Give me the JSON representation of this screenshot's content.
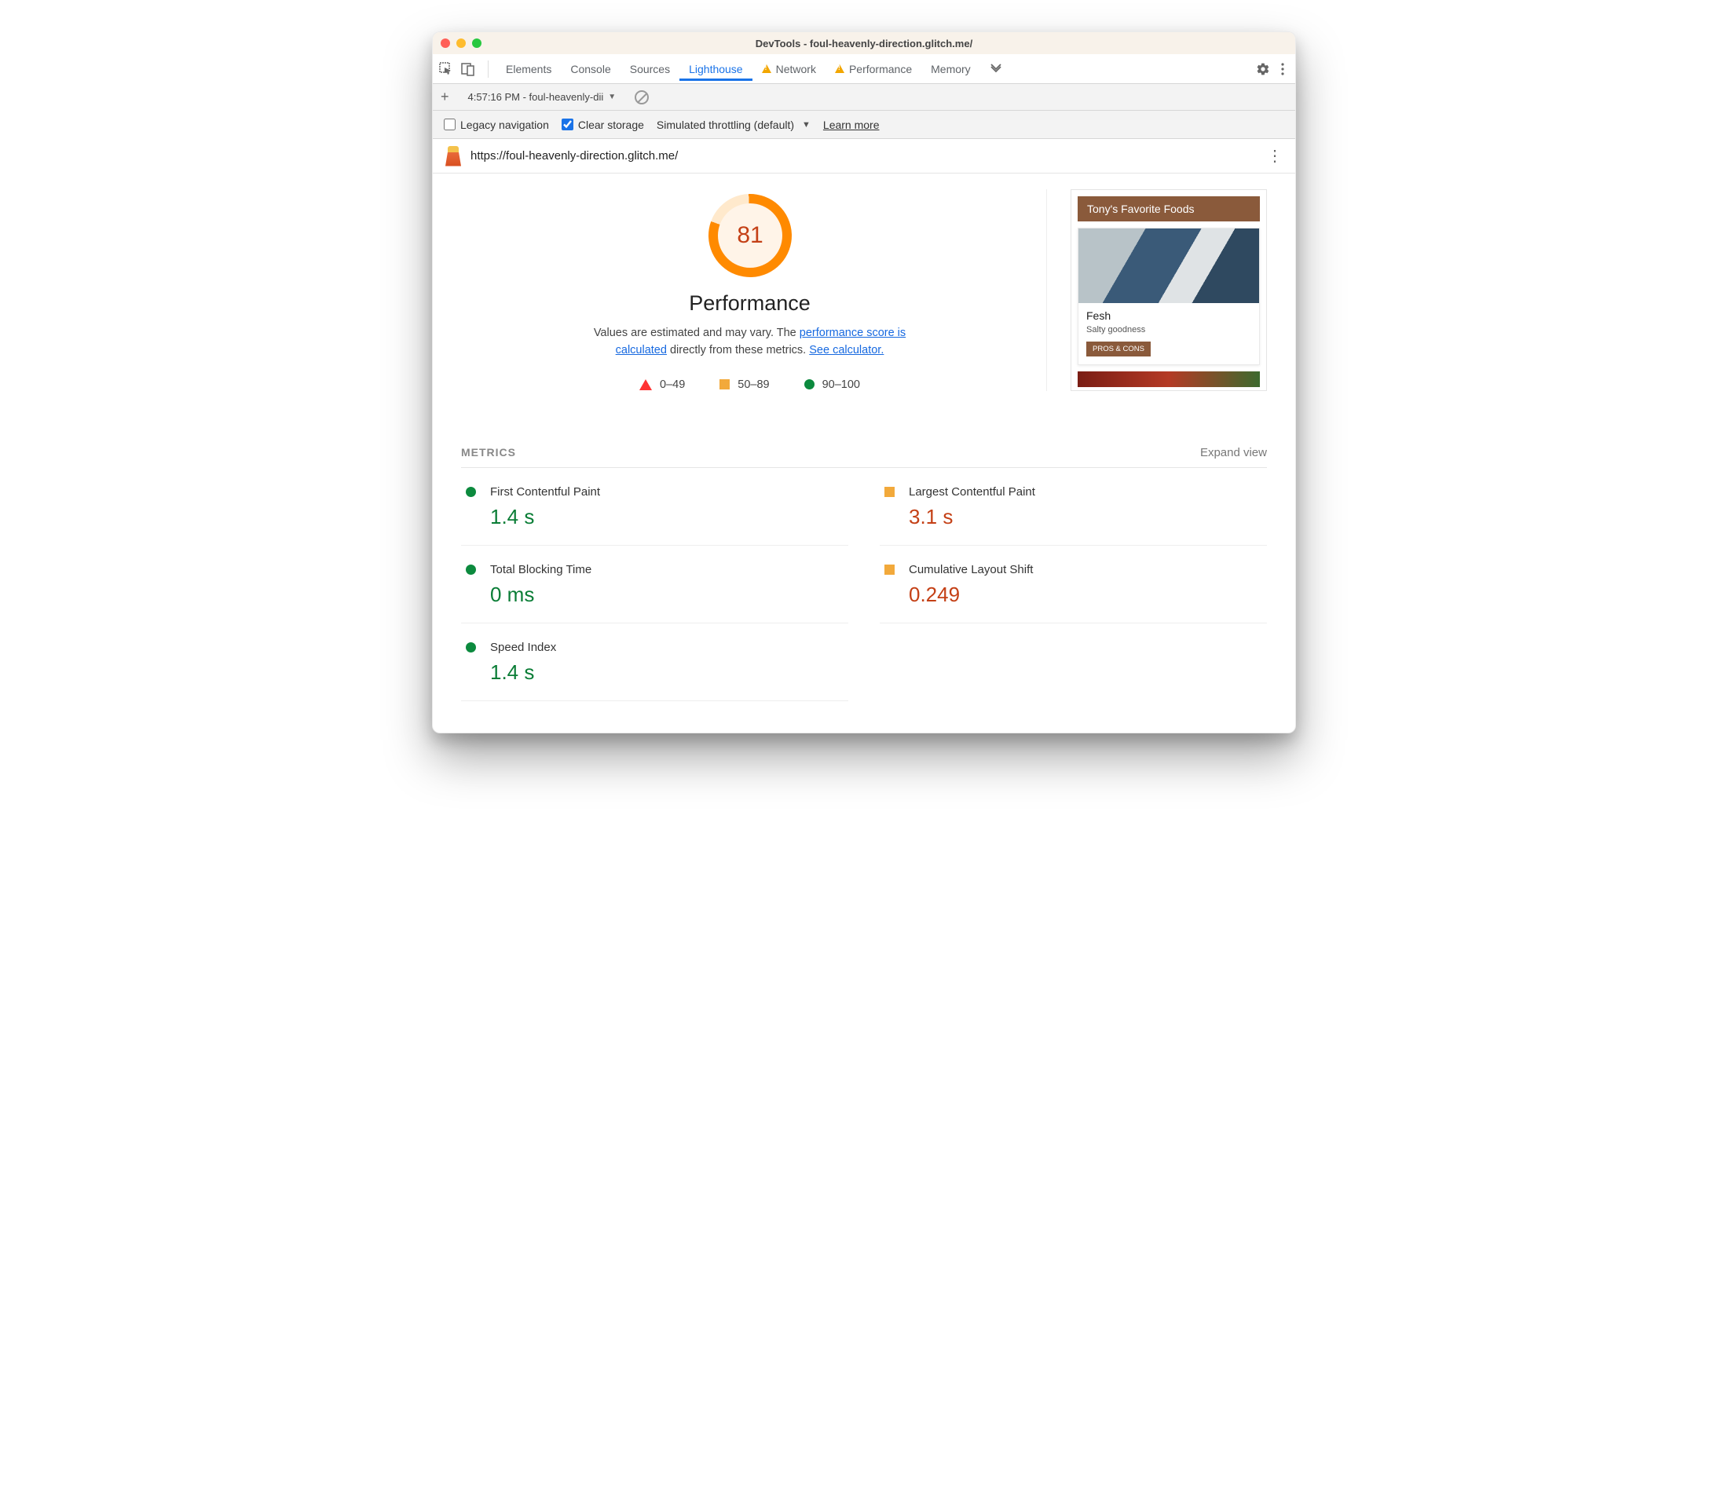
{
  "window": {
    "title": "DevTools - foul-heavenly-direction.glitch.me/"
  },
  "tabs": {
    "items": [
      "Elements",
      "Console",
      "Sources",
      "Lighthouse",
      "Network",
      "Performance",
      "Memory"
    ],
    "warn": [
      false,
      false,
      false,
      false,
      true,
      true,
      false
    ],
    "active": 3
  },
  "subbar": {
    "report_label": "4:57:16 PM - foul-heavenly-dii"
  },
  "options": {
    "legacy_label": "Legacy navigation",
    "legacy_checked": false,
    "clear_label": "Clear storage",
    "clear_checked": true,
    "throttle_label": "Simulated throttling (default)",
    "learn_more": "Learn more"
  },
  "urlbar": {
    "url": "https://foul-heavenly-direction.glitch.me/"
  },
  "gauge": {
    "score": "81",
    "title": "Performance"
  },
  "desc": {
    "p1": "Values are estimated and may vary. The ",
    "link1": "performance score is calculated",
    "p2": " directly from these metrics. ",
    "link2": "See calculator."
  },
  "legend": {
    "r0": "0–49",
    "r1": "50–89",
    "r2": "90–100"
  },
  "preview": {
    "header": "Tony's Favorite Foods",
    "card_title": "Fesh",
    "card_sub": "Salty goodness",
    "card_btn": "PROS & CONS"
  },
  "metrics": {
    "heading": "METRICS",
    "expand": "Expand view",
    "items": [
      {
        "name": "First Contentful Paint",
        "value": "1.4 s",
        "status": "pass"
      },
      {
        "name": "Largest Contentful Paint",
        "value": "3.1 s",
        "status": "avg"
      },
      {
        "name": "Total Blocking Time",
        "value": "0 ms",
        "status": "pass"
      },
      {
        "name": "Cumulative Layout Shift",
        "value": "0.249",
        "status": "avg"
      },
      {
        "name": "Speed Index",
        "value": "1.4 s",
        "status": "pass"
      }
    ]
  }
}
